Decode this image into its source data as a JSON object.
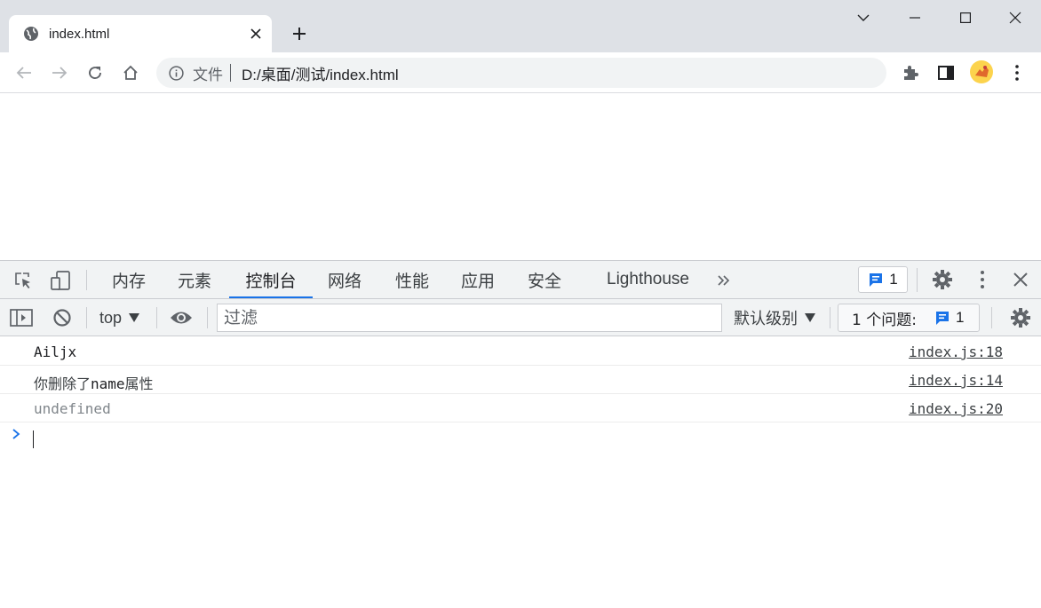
{
  "browser": {
    "tab": {
      "title": "index.html"
    },
    "window_controls": [
      "tab-search",
      "minimize",
      "maximize",
      "close"
    ],
    "omnibox": {
      "site_label": "文件",
      "url": "D:/桌面/测试/index.html"
    }
  },
  "devtools": {
    "tabs": [
      {
        "label": "内存",
        "active": false
      },
      {
        "label": "元素",
        "active": false
      },
      {
        "label": "控制台",
        "active": true
      },
      {
        "label": "网络",
        "active": false
      },
      {
        "label": "性能",
        "active": false
      },
      {
        "label": "应用",
        "active": false
      },
      {
        "label": "安全",
        "active": false
      },
      {
        "label": "Lighthouse",
        "active": false
      }
    ],
    "issues_badge_count": "1",
    "filterbar": {
      "context": "top",
      "filter_placeholder": "过滤",
      "levels": "默认级别",
      "issues_label": "1 个问题:",
      "issues_count": "1"
    },
    "console": {
      "messages": [
        {
          "text": "Ailjx",
          "source": "index.js:18"
        },
        {
          "text_prefix": "你删除了",
          "text_mono": "name",
          "text_suffix": "属性",
          "source": "index.js:14"
        },
        {
          "text": "undefined",
          "source": "index.js:20"
        }
      ]
    }
  },
  "colors": {
    "accent": "#1a73e8",
    "chrome_bg": "#dee1e6",
    "devtools_bar": "#f1f3f4"
  }
}
